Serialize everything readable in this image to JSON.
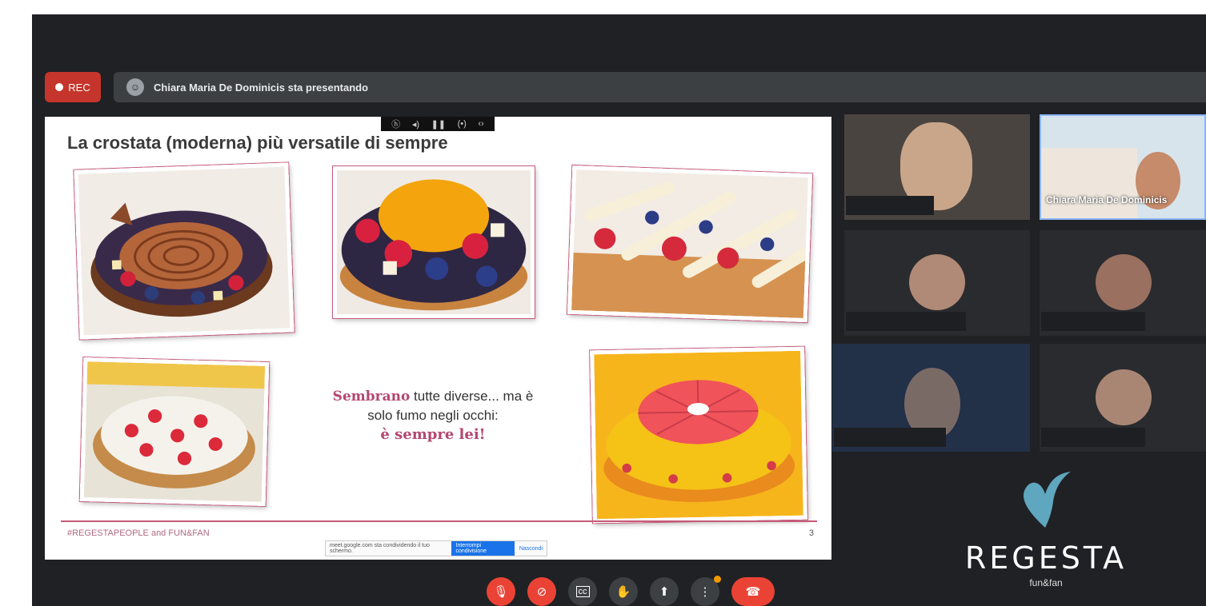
{
  "recording": {
    "label": "REC"
  },
  "presenter_bar": {
    "text": "Chiara Maria De Dominicis sta presentando"
  },
  "slide": {
    "title": "La crostata (moderna) più versatile di sempre",
    "slogan_highlight": "Sembrano",
    "slogan_rest": " tutte diverse... ma è",
    "slogan_line2": "solo fumo negli occhi:",
    "slogan_line3": "è sempre lei!",
    "footer": "#REGESTAPEOPLE and FUN&FAN",
    "page_number": "3",
    "toolbar_icons": [
      "hp-logo",
      "audio-icon",
      "pause-icon",
      "broadcast-icon",
      "code-icon"
    ]
  },
  "share_notice": {
    "text": "meet.google.com sta condividendo il tuo schermo.",
    "stop_label": "Interrompi condivisione",
    "hide_label": "Nascondi"
  },
  "participants": [
    {
      "name": "",
      "video": true
    },
    {
      "name": "Chiara Maria De Dominicis",
      "video": true,
      "active": true
    },
    {
      "name": "",
      "video": false
    },
    {
      "name": "",
      "video": false
    },
    {
      "name": "",
      "video": true
    },
    {
      "name": "",
      "video": false
    }
  ],
  "logo": {
    "word": "REGESTA",
    "sub": "fun&fan"
  },
  "controls": [
    "mic-off-icon",
    "camera-off-icon",
    "captions-icon",
    "raise-hand-icon",
    "present-icon",
    "more-icon",
    "end-call-icon"
  ],
  "colors": {
    "meet_bg": "#202124",
    "rec_red": "#c5352b",
    "danger": "#ea4335",
    "slide_accent": "#c45a7a"
  }
}
